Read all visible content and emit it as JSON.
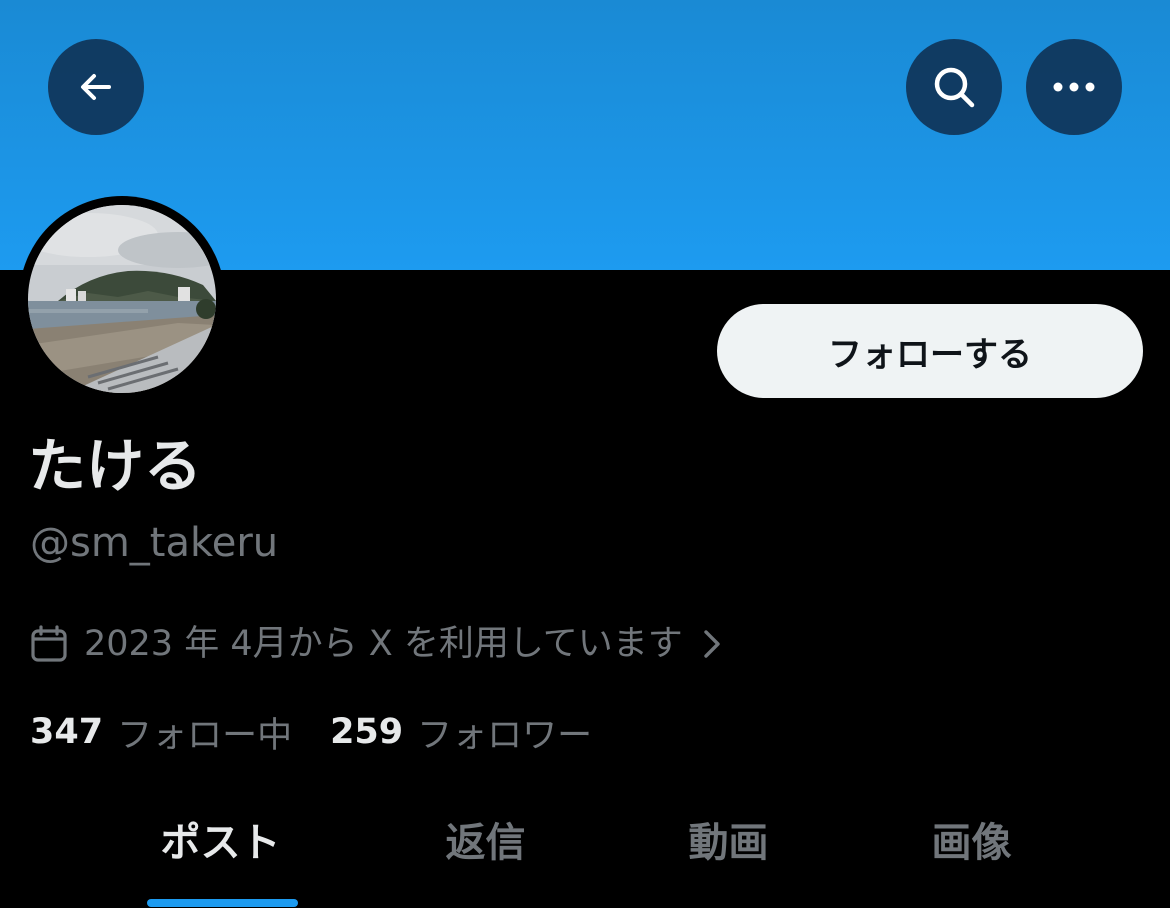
{
  "header": {
    "back_icon": "arrow-left-icon",
    "search_icon": "search-icon",
    "more_icon": "more-horizontal-icon",
    "banner_color": "#1d9bf0"
  },
  "profile": {
    "display_name": "たける",
    "handle": "@sm_takeru",
    "follow_label": "フォローする",
    "joined_icon": "calendar-icon",
    "joined_text": "2023 年 4月から X を利用しています",
    "following_count": "347",
    "following_label": "フォロー中",
    "followers_count": "259",
    "followers_label": "フォロワー"
  },
  "tabs": [
    {
      "label": "ポスト",
      "active": true
    },
    {
      "label": "返信",
      "active": false
    },
    {
      "label": "動画",
      "active": false
    },
    {
      "label": "画像",
      "active": false
    }
  ],
  "colors": {
    "accent": "#1d9bf0",
    "background": "#000000",
    "text_primary": "#e7e9ea",
    "text_secondary": "#71767b",
    "follow_button_bg": "#eff3f4"
  }
}
